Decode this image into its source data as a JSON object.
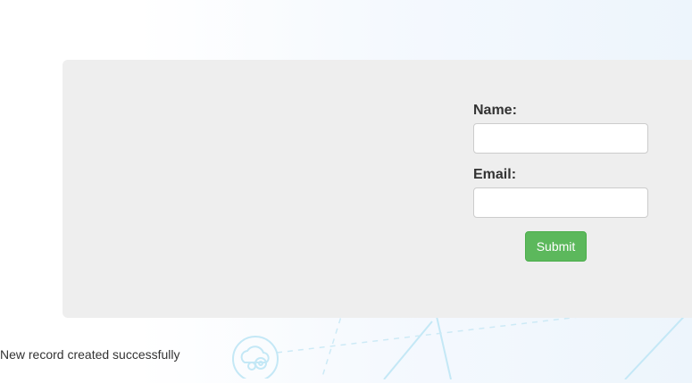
{
  "form": {
    "name_label": "Name:",
    "name_value": "",
    "email_label": "Email:",
    "email_value": "",
    "submit_label": "Submit"
  },
  "status": {
    "message": "New record created successfully"
  },
  "colors": {
    "panel_background": "#eeeeee",
    "submit_button": "#5cb85c",
    "decor_lines": "#bfe6f5"
  },
  "icons": {
    "background_decor": "cloud-gears-icon"
  }
}
